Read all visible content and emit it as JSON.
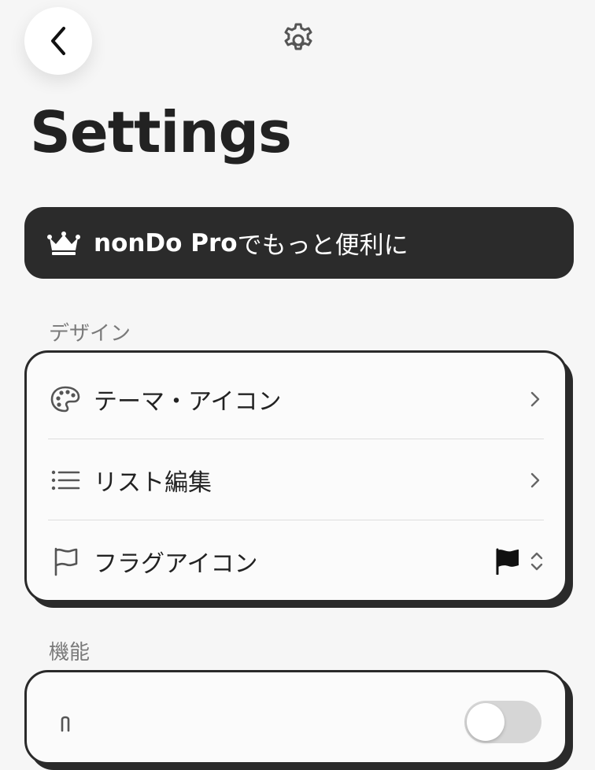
{
  "header": {
    "back_icon": "chevron-left-icon",
    "settings_icon": "gear-icon"
  },
  "page_title": "Settings",
  "pro_banner": {
    "icon": "crown-icon",
    "brand": "nonDo Pro",
    "suffix": "でもっと便利に"
  },
  "sections": {
    "design": {
      "label": "デザイン",
      "items": [
        {
          "label": "テーマ・アイコン",
          "icon": "palette-icon",
          "accessory": "chevron-right-icon"
        },
        {
          "label": "リスト編集",
          "icon": "list-icon",
          "accessory": "chevron-right-icon"
        },
        {
          "label": "フラグアイコン",
          "icon": "flag-icon",
          "value_icon": "flag-filled-icon",
          "accessory": "chevron-up-down-icon"
        }
      ]
    },
    "features": {
      "label": "機能",
      "items": [
        {
          "label": "",
          "icon": "partial-icon",
          "control": "toggle",
          "toggle_on": false
        }
      ]
    }
  },
  "colors": {
    "background": "#f6f6f6",
    "banner": "#2b2b2b",
    "card_border": "#2a2a2a",
    "section_label": "#7a7a7a"
  }
}
